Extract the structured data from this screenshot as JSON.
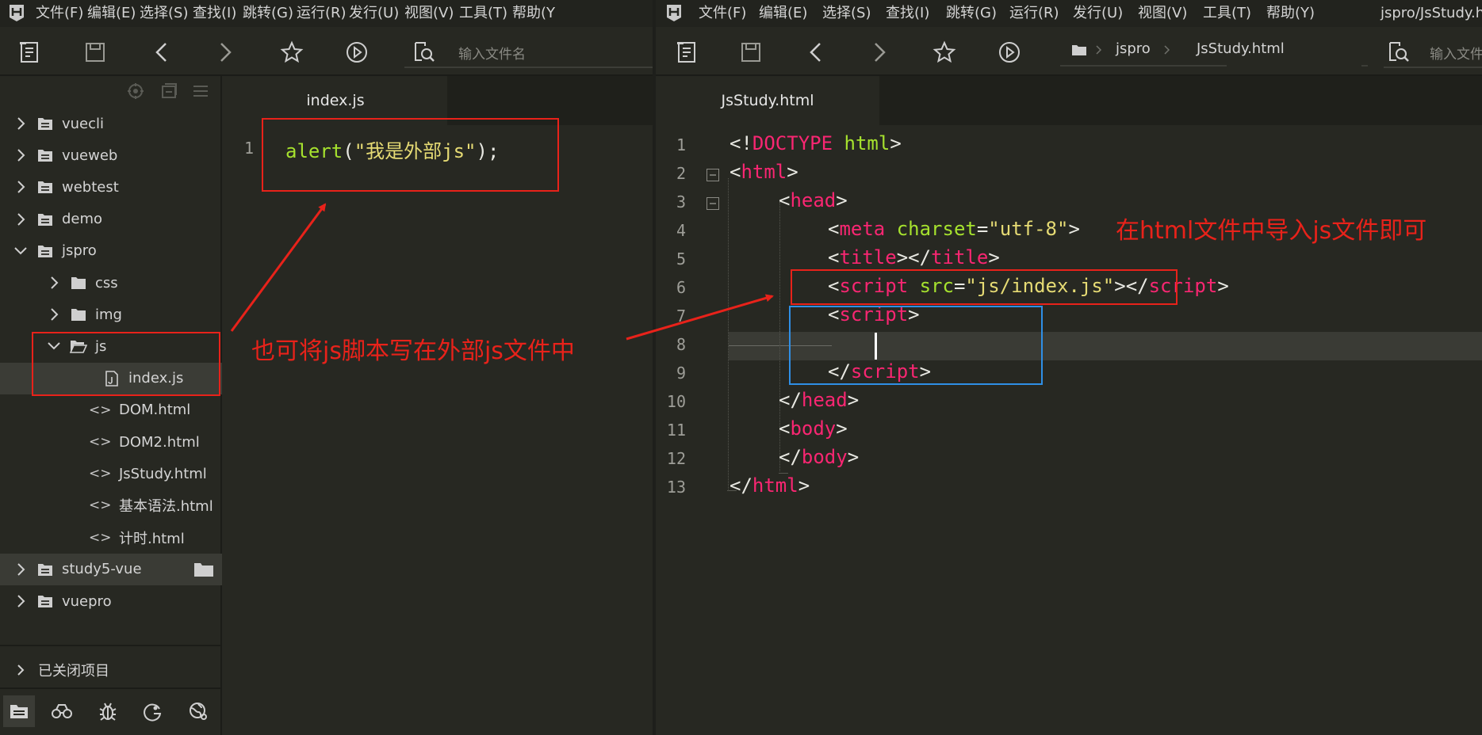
{
  "left": {
    "menu": [
      "文件(F)",
      "编辑(E)",
      "选择(S)",
      "查找(I)",
      "跳转(G)",
      "运行(R)",
      "发行(U)",
      "视图(V)",
      "工具(T)",
      "帮助(Y"
    ],
    "search_placeholder": "输入文件名",
    "tab": {
      "label": "index.js"
    },
    "tree": [
      {
        "label": "vuecli",
        "type": "project",
        "expanded": false
      },
      {
        "label": "vueweb",
        "type": "project",
        "expanded": false
      },
      {
        "label": "webtest",
        "type": "project",
        "expanded": false
      },
      {
        "label": "demo",
        "type": "project",
        "expanded": false
      },
      {
        "label": "jspro",
        "type": "project",
        "expanded": true
      },
      {
        "label": "css",
        "type": "folder",
        "expanded": false
      },
      {
        "label": "img",
        "type": "folder",
        "expanded": false
      },
      {
        "label": "js",
        "type": "folder",
        "expanded": true
      },
      {
        "label": "index.js",
        "type": "file"
      },
      {
        "label": "DOM.html",
        "type": "html"
      },
      {
        "label": "DOM2.html",
        "type": "html"
      },
      {
        "label": "JsStudy.html",
        "type": "html"
      },
      {
        "label": "基本语法.html",
        "type": "html"
      },
      {
        "label": "计时.html",
        "type": "html"
      },
      {
        "label": "study5-vue",
        "type": "project",
        "expanded": false
      },
      {
        "label": "vuepro",
        "type": "project",
        "expanded": false
      }
    ],
    "html_tag": "<>",
    "closed_projects": "已关闭项目",
    "line_number": "1",
    "code_line": {
      "fn": "alert",
      "open": "(",
      "str": "\"我是外部js\"",
      "close": ");"
    },
    "annotation": "也可将js脚本写在外部js文件中"
  },
  "right": {
    "menu": [
      "文件(F)",
      "编辑(E)",
      "选择(S)",
      "查找(I)",
      "跳转(G)",
      "运行(R)",
      "发行(U)",
      "视图(V)",
      "工具(T)",
      "帮助(Y)"
    ],
    "window_title": "jspro/JsStudy.h",
    "breadcrumb": [
      "jspro",
      "JsStudy.html"
    ],
    "search_placeholder": "输入文件名",
    "tab": {
      "label": "JsStudy.html"
    },
    "line_numbers": [
      "1",
      "2",
      "3",
      "4",
      "5",
      "6",
      "7",
      "8",
      "9",
      "10",
      "11",
      "12",
      "13"
    ],
    "annotation": "在html文件中导入js文件即可",
    "code": {
      "l1": [
        "<!",
        "DOCTYPE",
        " html",
        ">"
      ],
      "l2": [
        "<",
        "html",
        ">"
      ],
      "l3": [
        "<",
        "head",
        ">"
      ],
      "l4": [
        "<",
        "meta",
        " charset",
        "=",
        "\"utf-8\"",
        ">"
      ],
      "l5": [
        "<",
        "title",
        "></",
        "title",
        ">"
      ],
      "l6": [
        "<",
        "script",
        " src",
        "=",
        "\"js/index.js\"",
        "></",
        "script",
        ">"
      ],
      "l7": [
        "<",
        "script",
        ">"
      ],
      "l9": [
        "</",
        "script",
        ">"
      ],
      "l10": [
        "</",
        "head",
        ">"
      ],
      "l11": [
        "<",
        "body",
        ">"
      ],
      "l12": [
        "</",
        "body",
        ">"
      ],
      "l13": [
        "</",
        "html",
        ">"
      ]
    }
  },
  "colors": {
    "bg": "#272822",
    "tag": "#f92672",
    "attr": "#a6e22e",
    "string": "#e6db74",
    "annotation": "#e8221a",
    "blue_box": "#2f8fe6"
  }
}
